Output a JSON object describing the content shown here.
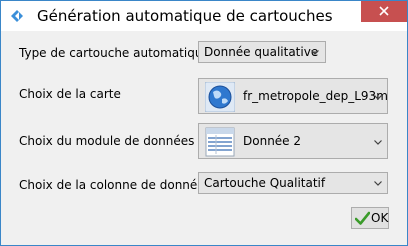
{
  "window": {
    "title": "Génération automatique de cartouches",
    "close_icon": "close-icon"
  },
  "form": {
    "type": {
      "label": "Type de cartouche automatique",
      "value": "Donnée qualitative"
    },
    "map": {
      "label": "Choix de la carte",
      "value": "fr_metropole_dep_L93m",
      "icon": "globe-icon"
    },
    "module": {
      "label": "Choix du module de données",
      "value": "Donnée 2",
      "icon": "data-table-icon"
    },
    "column": {
      "label": "Choix de la colonne de données",
      "value": "Cartouche Qualitatif"
    }
  },
  "buttons": {
    "ok_label": "OK",
    "ok_icon": "checkmark-icon"
  },
  "colors": {
    "accent_border": "#3a86c8",
    "close_red": "#c75050",
    "window_bg": "#f0f0f0"
  }
}
